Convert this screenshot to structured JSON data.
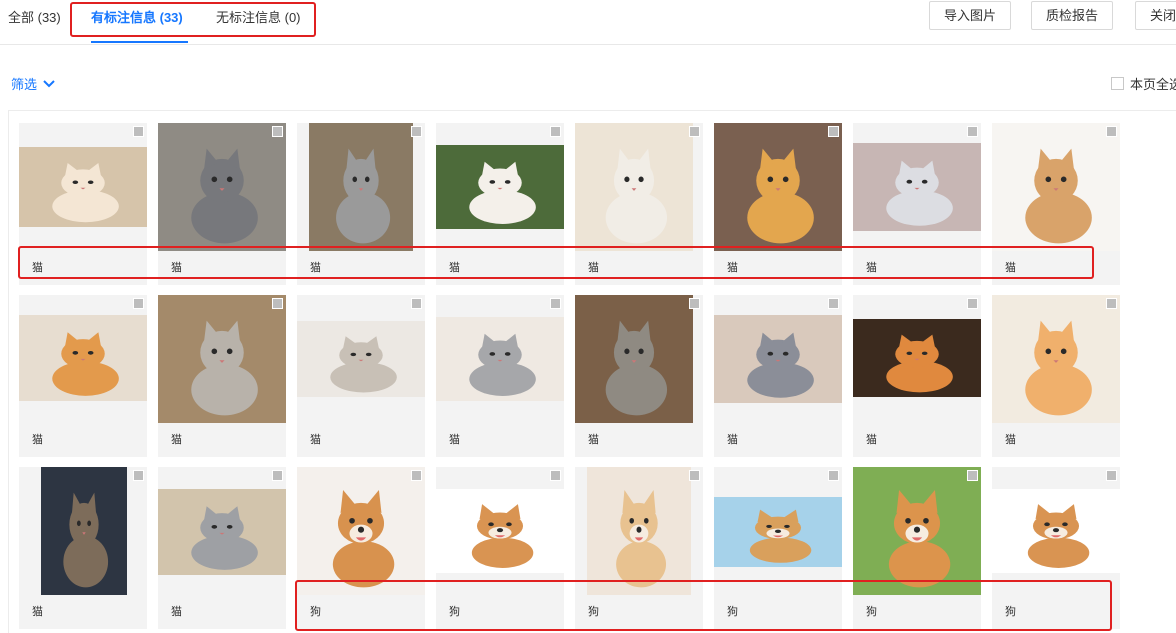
{
  "tabs": {
    "all": "全部 (33)",
    "labeled": "有标注信息 (33)",
    "unlabeled": "无标注信息 (0)"
  },
  "toolbar": {
    "import_label": "导入图片",
    "qc_report_label": "质检报告",
    "close_label": "关闭"
  },
  "filter": {
    "label": "筛选"
  },
  "select_page": {
    "label": "本页全选"
  },
  "accent_color": "#1677ff",
  "annotation_color": "#e02020",
  "rows": [
    [
      {
        "label": "猫",
        "subject": "cat",
        "bg": "#d6c4aa",
        "fg": "#f4e6d4"
      },
      {
        "label": "猫",
        "subject": "cat",
        "bg": "#8f8b84",
        "fg": "#77787c"
      },
      {
        "label": "猫",
        "subject": "cat",
        "bg": "#8a7a64",
        "fg": "#9a9a9a"
      },
      {
        "label": "猫",
        "subject": "cat",
        "bg": "#4d6b3a",
        "fg": "#f4f0ea"
      },
      {
        "label": "猫",
        "subject": "cat",
        "bg": "#ede4d6",
        "fg": "#f1ede6"
      },
      {
        "label": "猫",
        "subject": "cat",
        "bg": "#7a6050",
        "fg": "#e3a64e"
      },
      {
        "label": "猫",
        "subject": "cat",
        "bg": "#c7b6b4",
        "fg": "#dcdde2"
      },
      {
        "label": "猫",
        "subject": "cat",
        "bg": "#f7f5f2",
        "fg": "#d9a36a"
      }
    ],
    [
      {
        "label": "猫",
        "subject": "cat",
        "bg": "#e7ddd0",
        "fg": "#e39a4c"
      },
      {
        "label": "猫",
        "subject": "cat",
        "bg": "#a48a6a",
        "fg": "#b8b2aa"
      },
      {
        "label": "猫",
        "subject": "cat",
        "bg": "#ece8e3",
        "fg": "#c8c0b6"
      },
      {
        "label": "猫",
        "subject": "cat",
        "bg": "#efe9e2",
        "fg": "#a6a7aa"
      },
      {
        "label": "猫",
        "subject": "cat",
        "bg": "#7b6048",
        "fg": "#8f8a82"
      },
      {
        "label": "猫",
        "subject": "cat",
        "bg": "#d9c9bc",
        "fg": "#8b8e98"
      },
      {
        "label": "猫",
        "subject": "cat",
        "bg": "#3b2a1e",
        "fg": "#e0893e"
      },
      {
        "label": "猫",
        "subject": "cat",
        "bg": "#f2ebe0",
        "fg": "#f0b06c"
      }
    ],
    [
      {
        "label": "猫",
        "subject": "cat",
        "bg": "#2d3542",
        "fg": "#7d6c5a"
      },
      {
        "label": "猫",
        "subject": "cat",
        "bg": "#d2c4ac",
        "fg": "#9ea0a4"
      },
      {
        "label": "狗",
        "subject": "dog",
        "bg": "#f4f0ec",
        "fg": "#d8924e"
      },
      {
        "label": "狗",
        "subject": "dog",
        "bg": "#ffffff",
        "fg": "#d99452"
      },
      {
        "label": "狗",
        "subject": "dog",
        "bg": "#efe5da",
        "fg": "#e8c290"
      },
      {
        "label": "狗",
        "subject": "dog",
        "bg": "#a6d2ea",
        "fg": "#d9a05c"
      },
      {
        "label": "狗",
        "subject": "dog",
        "bg": "#7fae54",
        "fg": "#dc944c"
      },
      {
        "label": "狗",
        "subject": "dog",
        "bg": "#ffffff",
        "fg": "#d99452"
      }
    ]
  ]
}
